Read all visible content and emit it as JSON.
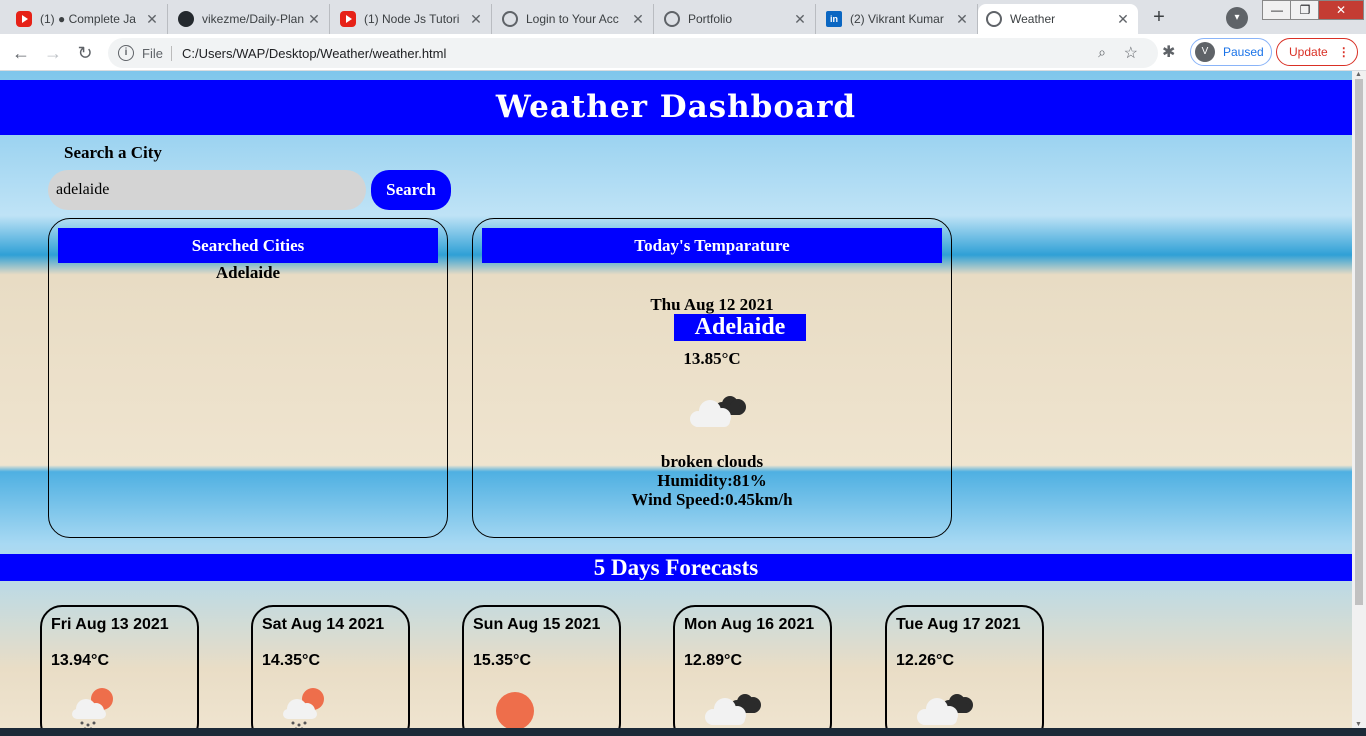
{
  "browser": {
    "tabs": [
      {
        "icon": "youtube-icon",
        "title": "(1) ● Complete Ja"
      },
      {
        "icon": "github-icon",
        "title": "vikezme/Daily-Plan"
      },
      {
        "icon": "youtube-icon",
        "title": "(1) Node Js Tutori"
      },
      {
        "icon": "globe-icon",
        "title": "Login to Your Acc"
      },
      {
        "icon": "globe-icon",
        "title": "Portfolio"
      },
      {
        "icon": "linkedin-icon",
        "title": "(2) Vikrant Kumar"
      },
      {
        "icon": "globe-icon",
        "title": "Weather"
      }
    ],
    "address_scheme": "File",
    "address_url": "C:/Users/WAP/Desktop/Weather/weather.html",
    "profile_initial": "V",
    "profile_status": "Paused",
    "update_label": "Update"
  },
  "app": {
    "title": "Weather Dashboard",
    "search_label": "Search a City",
    "search_value": "adelaide",
    "search_button": "Search"
  },
  "searched": {
    "heading": "Searched Cities",
    "cities": [
      "Adelaide"
    ]
  },
  "today": {
    "heading": "Today's Temparature",
    "date": "Thu Aug 12 2021",
    "city": "Adelaide",
    "temp": "13.85°C",
    "icon": "broken-clouds-icon",
    "description": "broken clouds",
    "humidity": "Humidity:81%",
    "wind": "Wind Speed:0.45km/h"
  },
  "forecast": {
    "heading": "5 Days Forecasts",
    "days": [
      {
        "date": "Fri Aug 13 2021",
        "temp": "13.94°C",
        "icon": "rain-sun-icon"
      },
      {
        "date": "Sat Aug 14 2021",
        "temp": "14.35°C",
        "icon": "rain-sun-icon"
      },
      {
        "date": "Sun Aug 15 2021",
        "temp": "15.35°C",
        "icon": "sun-icon"
      },
      {
        "date": "Mon Aug 16 2021",
        "temp": "12.89°C",
        "icon": "broken-clouds-icon"
      },
      {
        "date": "Tue Aug 17 2021",
        "temp": "12.26°C",
        "icon": "broken-clouds-icon"
      }
    ]
  },
  "colors": {
    "accent": "#0000ff",
    "sun": "#ee6e4b",
    "cloud_dark": "#2b2b2b"
  }
}
